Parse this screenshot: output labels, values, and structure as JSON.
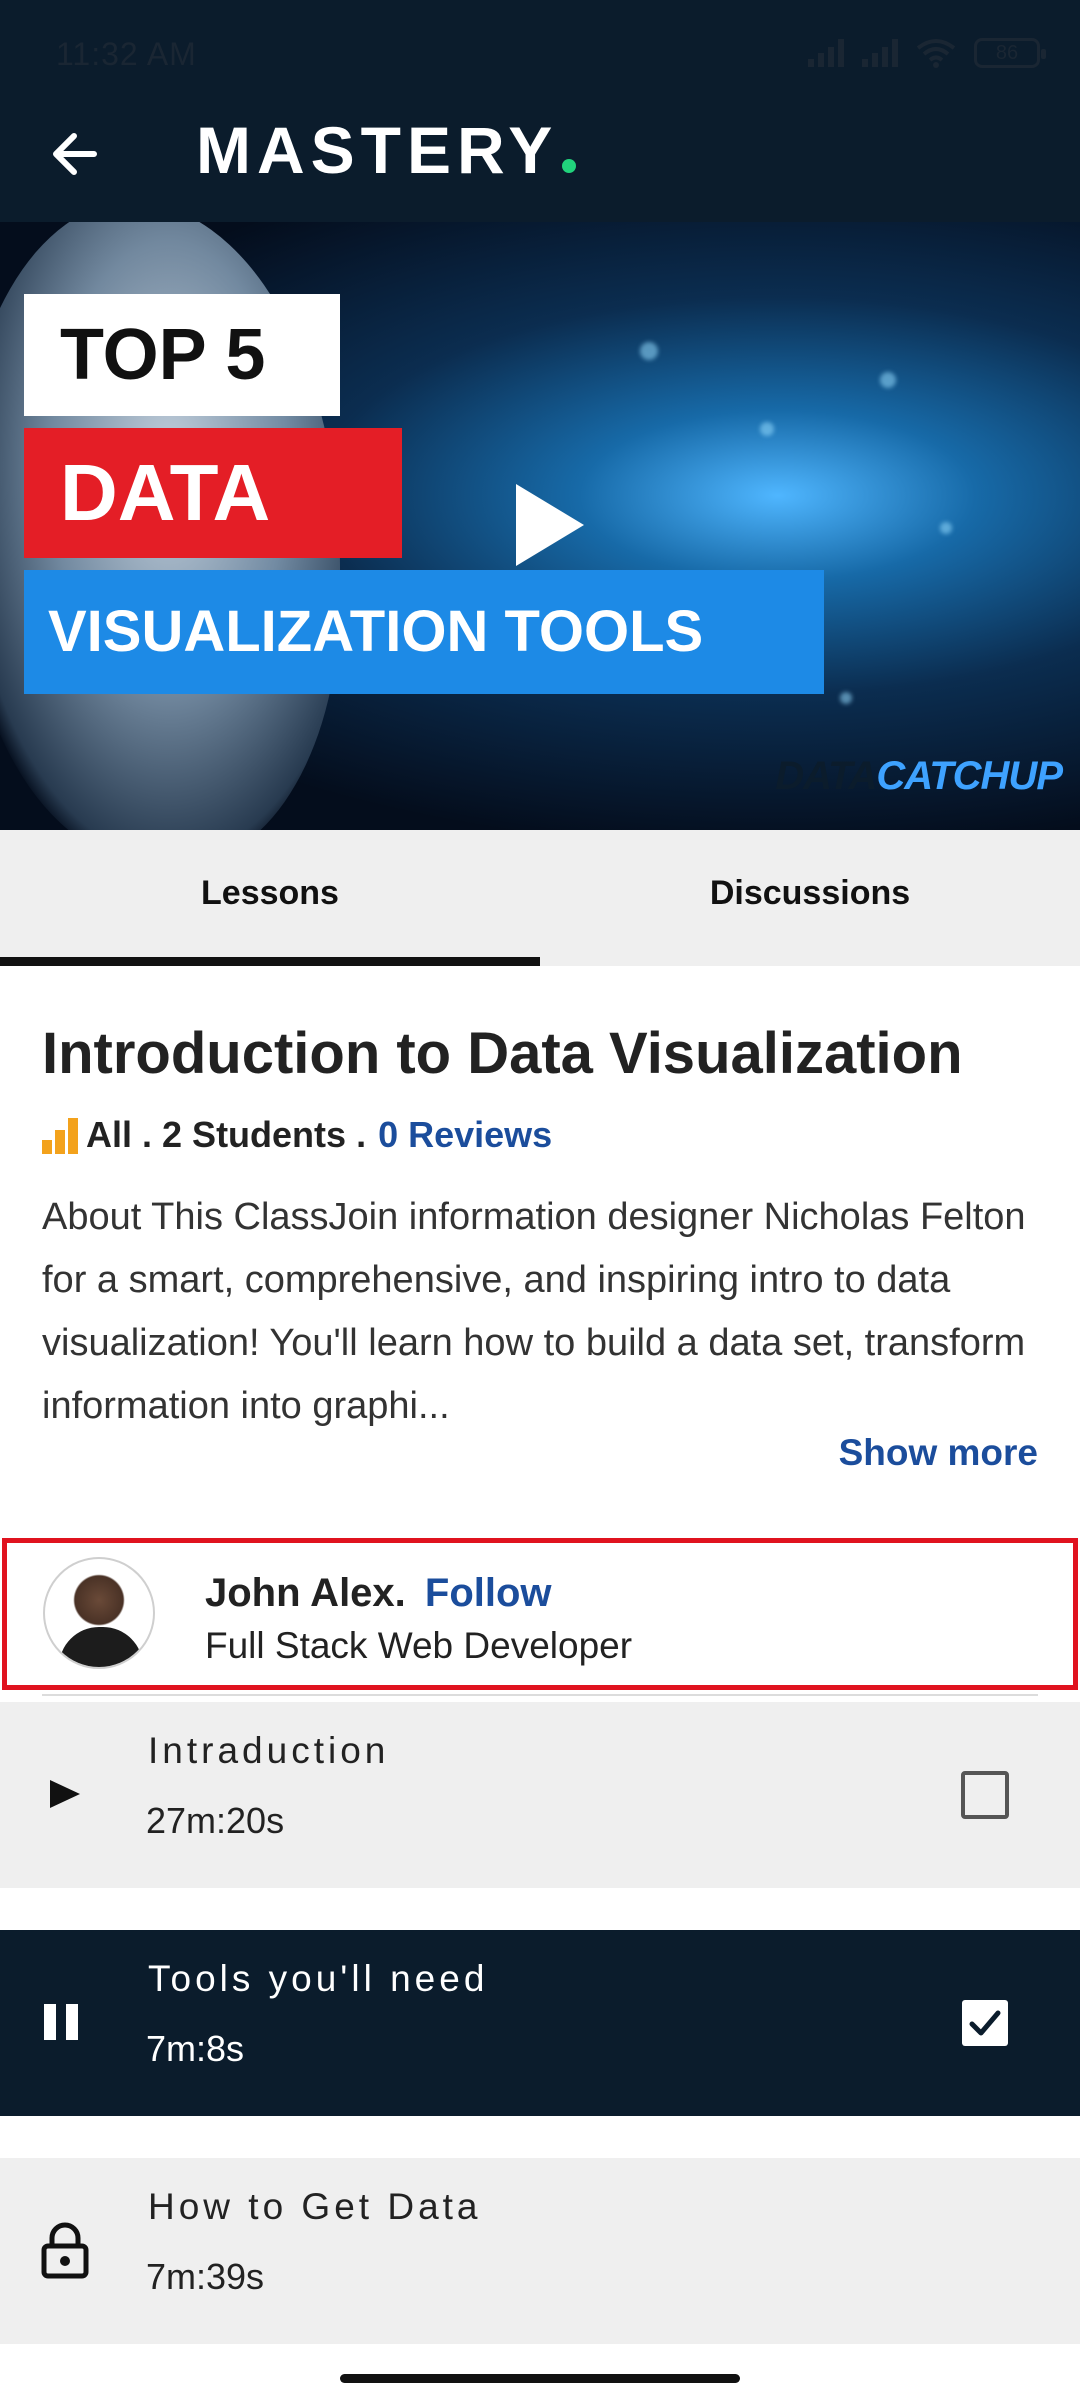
{
  "status_bar": {
    "time": "11:32 AM",
    "battery": "86"
  },
  "header": {
    "logo": "MASTERY"
  },
  "video": {
    "line1": "TOP 5",
    "line2": "DATA",
    "line3": "VISUALIZATION TOOLS",
    "brand_a": "DATA",
    "brand_b": "CATCHUP"
  },
  "tabs": [
    {
      "label": "Lessons",
      "active": true
    },
    {
      "label": "Discussions",
      "active": false
    }
  ],
  "course": {
    "title": "Introduction to Data Visualization",
    "level": "All",
    "sep": ".",
    "students": "2 Students",
    "reviews": "0 Reviews",
    "description": "About This ClassJoin information designer Nicholas Felton for a smart, comprehensive, and inspiring intro to data visualization! You'll learn how to build a data set, transform information into graphi...",
    "show_more": "Show more"
  },
  "instructor": {
    "name": "John Alex.",
    "follow": "Follow",
    "role": "Full Stack Web Developer"
  },
  "lessons": [
    {
      "title": "Intraduction",
      "duration": "27m:20s",
      "state": "play",
      "checked": false
    },
    {
      "title": "Tools you'll need",
      "duration": "7m:8s",
      "state": "pause",
      "checked": true
    },
    {
      "title": "How to Get Data",
      "duration": "7m:39s",
      "state": "locked",
      "checked": false
    }
  ],
  "colors": {
    "header_bg": "#0b1c2c",
    "accent_link": "#1b4d9c",
    "highlight_border": "#e0131f",
    "logo_dot": "#21d37c"
  }
}
